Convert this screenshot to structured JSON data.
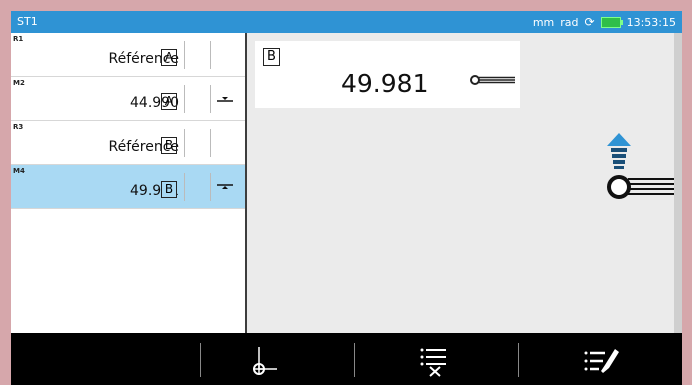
{
  "statusbar": {
    "title": "ST1",
    "units": "mm",
    "angle_units": "rad",
    "sync_icon": "sync-icon",
    "battery_icon": "battery-icon",
    "time": "13:53:15"
  },
  "list": {
    "rows": [
      {
        "tag": "R1",
        "value": "Référence",
        "datum": "A",
        "tolerance_icon": ""
      },
      {
        "tag": "M2",
        "value": "44.990",
        "datum": "A",
        "tolerance_icon": "tolerance-lower-icon"
      },
      {
        "tag": "R3",
        "value": "Référence",
        "datum": "B",
        "tolerance_icon": ""
      },
      {
        "tag": "M4",
        "value": "49.981",
        "datum": "B",
        "tolerance_icon": "tolerance-upper-icon"
      }
    ]
  },
  "card": {
    "datum": "B",
    "value": "49.981",
    "probe_icon": "probe-icon"
  },
  "colors": {
    "statusbar": "#2f93d4",
    "selected_row": "#a9d9f3",
    "frame": "#d6a7ab"
  },
  "bottombar": {
    "buttons": [
      {
        "icon": "datum-origin-icon"
      },
      {
        "icon": "list-delete-icon"
      },
      {
        "icon": "list-edit-icon"
      }
    ]
  }
}
